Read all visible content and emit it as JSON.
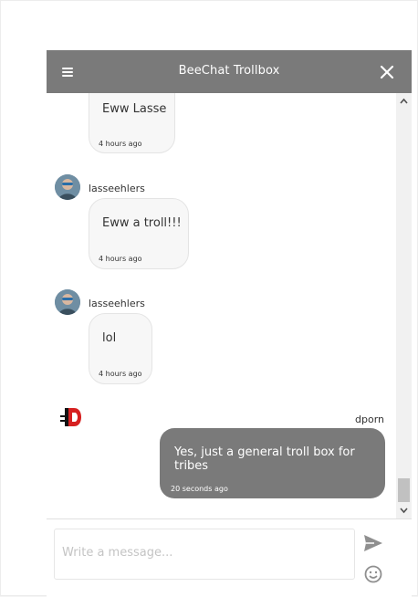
{
  "header": {
    "title": "BeeChat Trollbox"
  },
  "messages": [
    {
      "user": "",
      "text": "Eww Lasse",
      "time": "4 hours ago",
      "direction": "incoming"
    },
    {
      "user": "lasseehlers",
      "text": "Eww a troll!!!",
      "time": "4 hours ago",
      "direction": "incoming"
    },
    {
      "user": "lasseehlers",
      "text": "lol",
      "time": "4 hours ago",
      "direction": "incoming"
    },
    {
      "user": "dporn",
      "text": "Yes, just a general troll box for tribes",
      "time": "20 seconds ago",
      "direction": "outgoing"
    }
  ],
  "composer": {
    "placeholder": "Write a message..."
  },
  "icons": {
    "menu": "hamburger-menu-icon",
    "close": "close-icon",
    "send": "send-icon",
    "emoji": "emoji-icon"
  },
  "colors": {
    "header": "#7a7a7a",
    "outgoing_bubble": "#7a7a7a",
    "incoming_bubble": "#f7f7f7"
  }
}
